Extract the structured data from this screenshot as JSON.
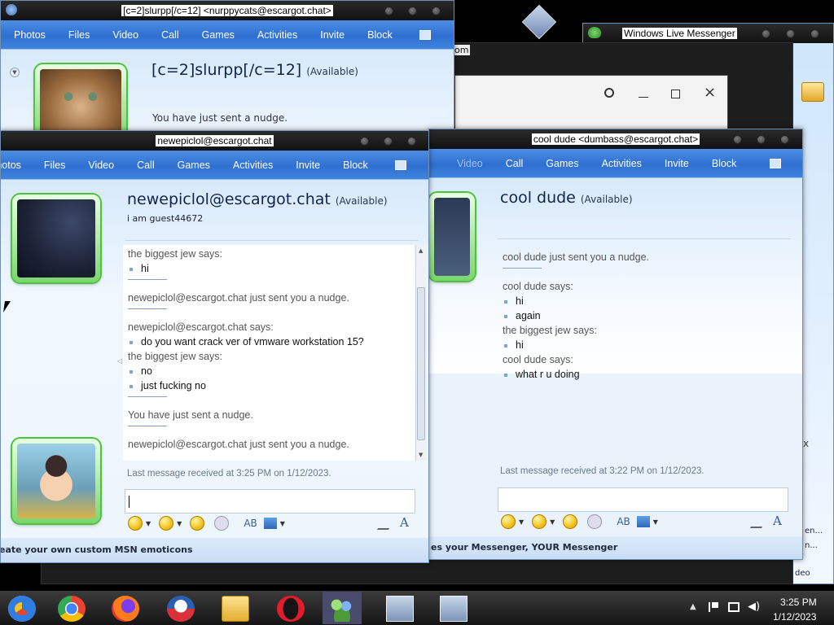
{
  "windows": {
    "nurppy": {
      "title": "[c=2]slurpp[/c=12] <nurppycats@escargot.chat>",
      "menu": [
        "Photos",
        "Files",
        "Video",
        "Call",
        "Games",
        "Activities",
        "Invite",
        "Block"
      ],
      "contact_name": "[c=2]slurpp[/c=12]",
      "status": "(Available)",
      "message_preview": "You have just sent a nudge."
    },
    "wlm": {
      "title": "Windows Live Messenger"
    },
    "newepic": {
      "title": "newepiclol@escargot.chat",
      "menu": [
        "Photos",
        "Files",
        "Video",
        "Call",
        "Games",
        "Activities",
        "Invite",
        "Block"
      ],
      "contact_name": "newepiclol@escargot.chat",
      "status": "(Available)",
      "psm": "i am guest44672",
      "messages": [
        {
          "type": "sender",
          "text": "the biggest jew says:"
        },
        {
          "type": "msg",
          "text": "hi"
        },
        {
          "type": "sep"
        },
        {
          "type": "nudge",
          "text": "newepiclol@escargot.chat just sent you a nudge."
        },
        {
          "type": "sep"
        },
        {
          "type": "sender",
          "text": "newepiclol@escargot.chat says:"
        },
        {
          "type": "msg",
          "text": "do you want crack ver of vmware workstation 15?"
        },
        {
          "type": "sender",
          "text": "the biggest jew says:"
        },
        {
          "type": "msg",
          "text": "no"
        },
        {
          "type": "msg",
          "text": "just fucking no"
        },
        {
          "type": "sep"
        },
        {
          "type": "nudge",
          "text": "You have just sent a nudge."
        },
        {
          "type": "sep"
        },
        {
          "type": "nudge",
          "text": "newepiclol@escargot.chat just sent you a nudge."
        }
      ],
      "last_message": "Last message received at 3:25 PM on 1/12/2023.",
      "ad_text": "eate your own custom MSN emoticons"
    },
    "cooldude": {
      "title": "cool dude <dumbass@escargot.chat>",
      "menu": [
        "Video",
        "Call",
        "Games",
        "Activities",
        "Invite",
        "Block"
      ],
      "contact_name": "cool dude",
      "status": "(Available)",
      "messages": [
        {
          "type": "nudge",
          "text": "cool dude just sent you a nudge."
        },
        {
          "type": "sep"
        },
        {
          "type": "sender",
          "text": "cool dude says:"
        },
        {
          "type": "msg",
          "text": "hi"
        },
        {
          "type": "msg",
          "text": "again"
        },
        {
          "type": "sender",
          "text": "the biggest jew says:"
        },
        {
          "type": "msg",
          "text": "hi"
        },
        {
          "type": "sender",
          "text": "cool dude says:"
        },
        {
          "type": "msg",
          "text": "what r u doing"
        }
      ],
      "last_message": "Last message received at 3:22 PM on 1/12/2023.",
      "ad_text": "es your Messenger, YOUR Messenger"
    },
    "background": {
      "fragment_om": "om",
      "fragment_en": "en...",
      "fragment_n": "n...",
      "fragment_deo": "deo",
      "fragment_x": "x"
    }
  },
  "taskbar": {
    "time": "3:25 PM",
    "date": "1/12/2023"
  },
  "colors": {
    "accent": "#2f6fd0",
    "presence_green": "#4cc33c"
  }
}
